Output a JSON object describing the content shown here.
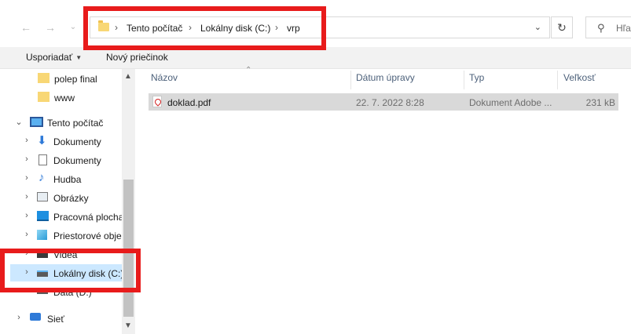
{
  "address_bar": {
    "breadcrumbs": [
      "Tento počítač",
      "Lokálny disk (C:)",
      "vrp"
    ],
    "separator": "›",
    "dropdown_glyph": "⌄",
    "refresh_glyph": "↻",
    "back_glyph": "←",
    "forward_glyph": "→"
  },
  "search": {
    "placeholder": "Hľa",
    "icon": "search-icon"
  },
  "command_bar": {
    "organize_label": "Usporiadať",
    "new_folder_label": "Nový priečinok"
  },
  "nav_pane": {
    "items": [
      {
        "label": "polep final",
        "icon": "folder-icon",
        "level": 2
      },
      {
        "label": "www",
        "icon": "folder-icon",
        "level": 2
      },
      {
        "label": "Tento počítač",
        "icon": "computer-icon",
        "level": 0,
        "expanded": true
      },
      {
        "label": "Dokumenty",
        "icon": "download-icon",
        "level": 1
      },
      {
        "label": "Dokumenty",
        "icon": "document-icon",
        "level": 1
      },
      {
        "label": "Hudba",
        "icon": "music-icon",
        "level": 1
      },
      {
        "label": "Obrázky",
        "icon": "pictures-icon",
        "level": 1
      },
      {
        "label": "Pracovná plocha",
        "icon": "desktop-icon",
        "level": 1
      },
      {
        "label": "Priestorové obje",
        "icon": "3d-objects-icon",
        "level": 1
      },
      {
        "label": "Videá",
        "icon": "video-icon",
        "level": 1
      },
      {
        "label": "Lokálny disk (C:)",
        "icon": "drive-icon",
        "level": 1,
        "selected": true
      },
      {
        "label": "Data (D:)",
        "icon": "drive-icon",
        "level": 1
      },
      {
        "label": "Sieť",
        "icon": "network-icon",
        "level": 0
      }
    ]
  },
  "columns": {
    "name": "Názov",
    "date": "Dátum úpravy",
    "type": "Typ",
    "size": "Veľkosť"
  },
  "files": [
    {
      "name": "doklad.pdf",
      "date": "22. 7. 2022 8:28",
      "type": "Dokument Adobe ...",
      "size": "231 kB",
      "icon": "pdf-icon"
    }
  ],
  "highlight_color": "#e81b1b",
  "selection_color": "#cce8ff"
}
